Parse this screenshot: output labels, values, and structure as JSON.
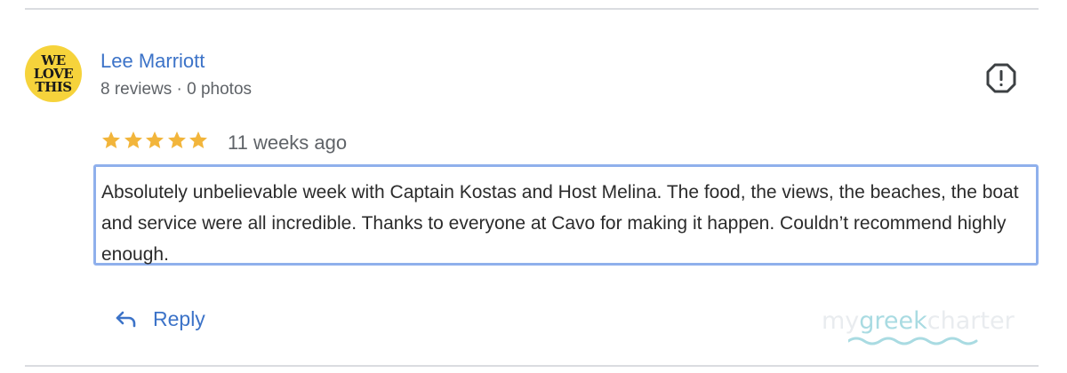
{
  "review": {
    "author": "Lee Marriott",
    "meta": "8 reviews · 0 photos",
    "avatar_lines": [
      "WE",
      "LOVE",
      "THIS"
    ],
    "rating": 5,
    "time": "11 weeks ago",
    "text": "Absolutely unbelievable week with Captain Kostas and Host Melina. The food, the views, the beaches, the boat and service were all incredible. Thanks to everyone at Cavo for making it happen. Couldn’t recommend highly enough."
  },
  "actions": {
    "reply_label": "Reply",
    "report_icon": "report-icon",
    "reply_icon": "reply-arrow-icon"
  },
  "watermark": {
    "part1": "my",
    "part2": "greek",
    "part3": "charter"
  },
  "colors": {
    "link_blue": "#3c73c8",
    "star_gold": "#f2b53b",
    "review_border": "#8fb0ec",
    "avatar_yellow": "#f6d33b"
  }
}
